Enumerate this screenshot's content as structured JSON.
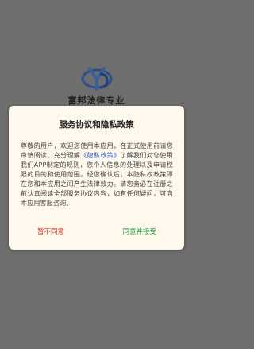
{
  "splash": {
    "app_name": "富邦法律专业"
  },
  "dialog": {
    "title": "服务协议和隐私政策",
    "body_part1": "尊敬的用户，欢迎您使用本应用，在正式使用前请您审慎阅读、充分理解",
    "policy_link": "《隐私政策》",
    "body_part2": "了解我们对您使用我们APP制定的规则，您个人信息的处理以及申请权限的目的和使用范围。经您确认后，本隐私权政策即在您和本应用之间产生法律效力。请您务必在注册之前认真阅读全部服务协议内容，如有任何疑问，可向本应用客服咨询。",
    "disagree_label": "暂不同意",
    "agree_label": "同意并接受"
  },
  "colors": {
    "disagree": "#d33a2c",
    "agree": "#2aa84a",
    "link": "#2756c7",
    "dialog_bg": "#fff8ec"
  }
}
